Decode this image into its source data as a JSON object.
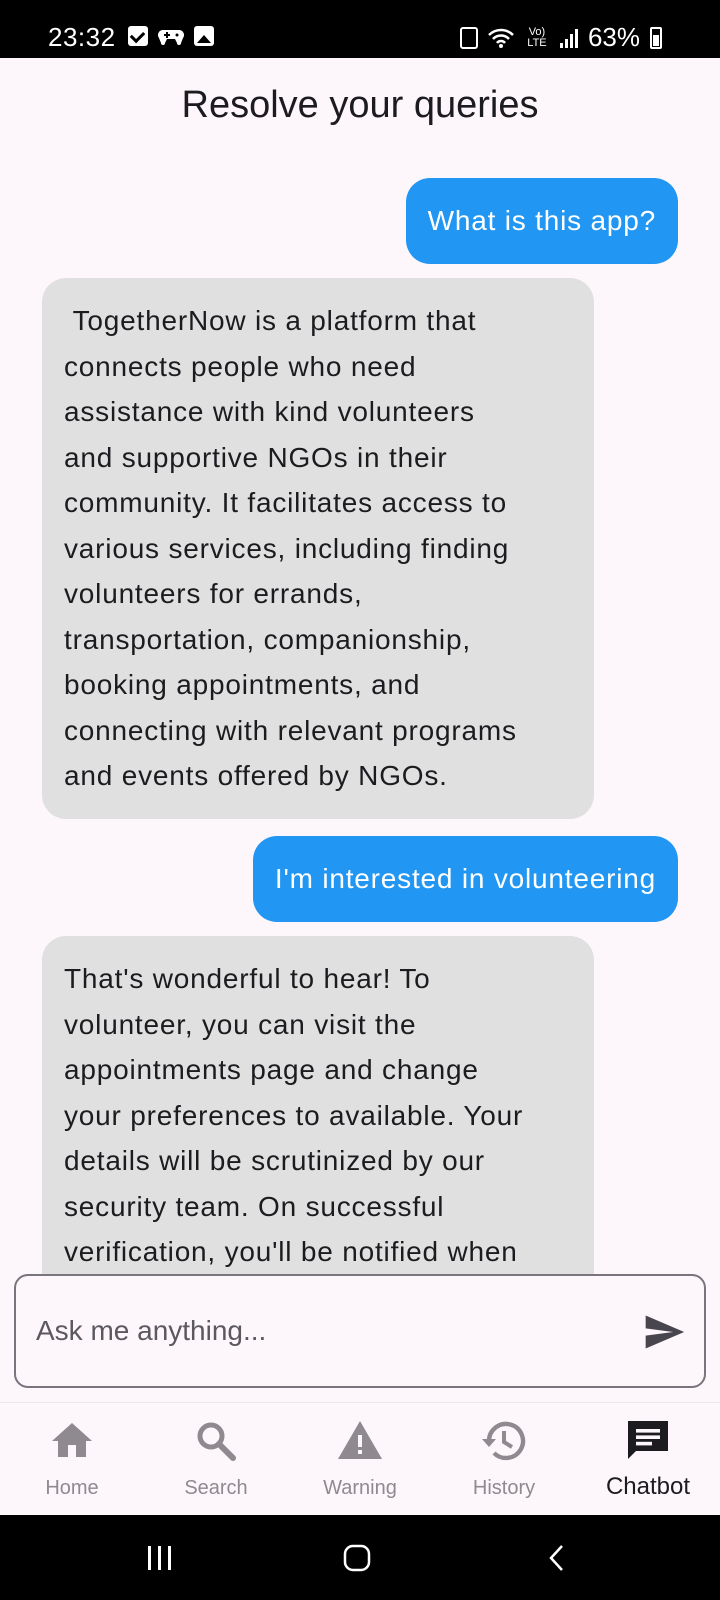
{
  "status_bar": {
    "time": "23:32",
    "lte_label": "Vo) LTE",
    "battery": "63%"
  },
  "header": {
    "title": "Resolve your queries"
  },
  "chat": {
    "messages": [
      {
        "role": "user",
        "text": "What is this app?"
      },
      {
        "role": "bot",
        "text": " TogetherNow is a platform that\nconnects people who need\nassistance with kind volunteers\nand supportive NGOs in their\ncommunity. It facilitates access to\nvarious services, including finding\nvolunteers for errands,\ntransportation, companionship,\nbooking appointments, and\nconnecting with relevant programs\nand events offered by NGOs."
      },
      {
        "role": "user",
        "text": "I'm interested in volunteering"
      },
      {
        "role": "bot",
        "text": "That's wonderful to hear! To\nvolunteer, you can visit the\nappointments page and change\nyour preferences to available. Your\ndetails will be scrutinized by our\nsecurity team. On successful\nverification, you'll be notified when"
      }
    ]
  },
  "input": {
    "placeholder": "Ask me anything...",
    "value": ""
  },
  "bottom_nav": {
    "items": [
      {
        "label": "Home",
        "icon": "home-icon"
      },
      {
        "label": "Search",
        "icon": "search-icon"
      },
      {
        "label": "Warning",
        "icon": "warning-icon"
      },
      {
        "label": "History",
        "icon": "history-icon"
      },
      {
        "label": "Chatbot",
        "icon": "chat-icon",
        "active": true
      }
    ]
  },
  "colors": {
    "user_bubble": "#2196f3",
    "bot_bubble": "#e0e0e0",
    "background": "#fdf7fc",
    "nav_inactive": "#8e8a90"
  }
}
